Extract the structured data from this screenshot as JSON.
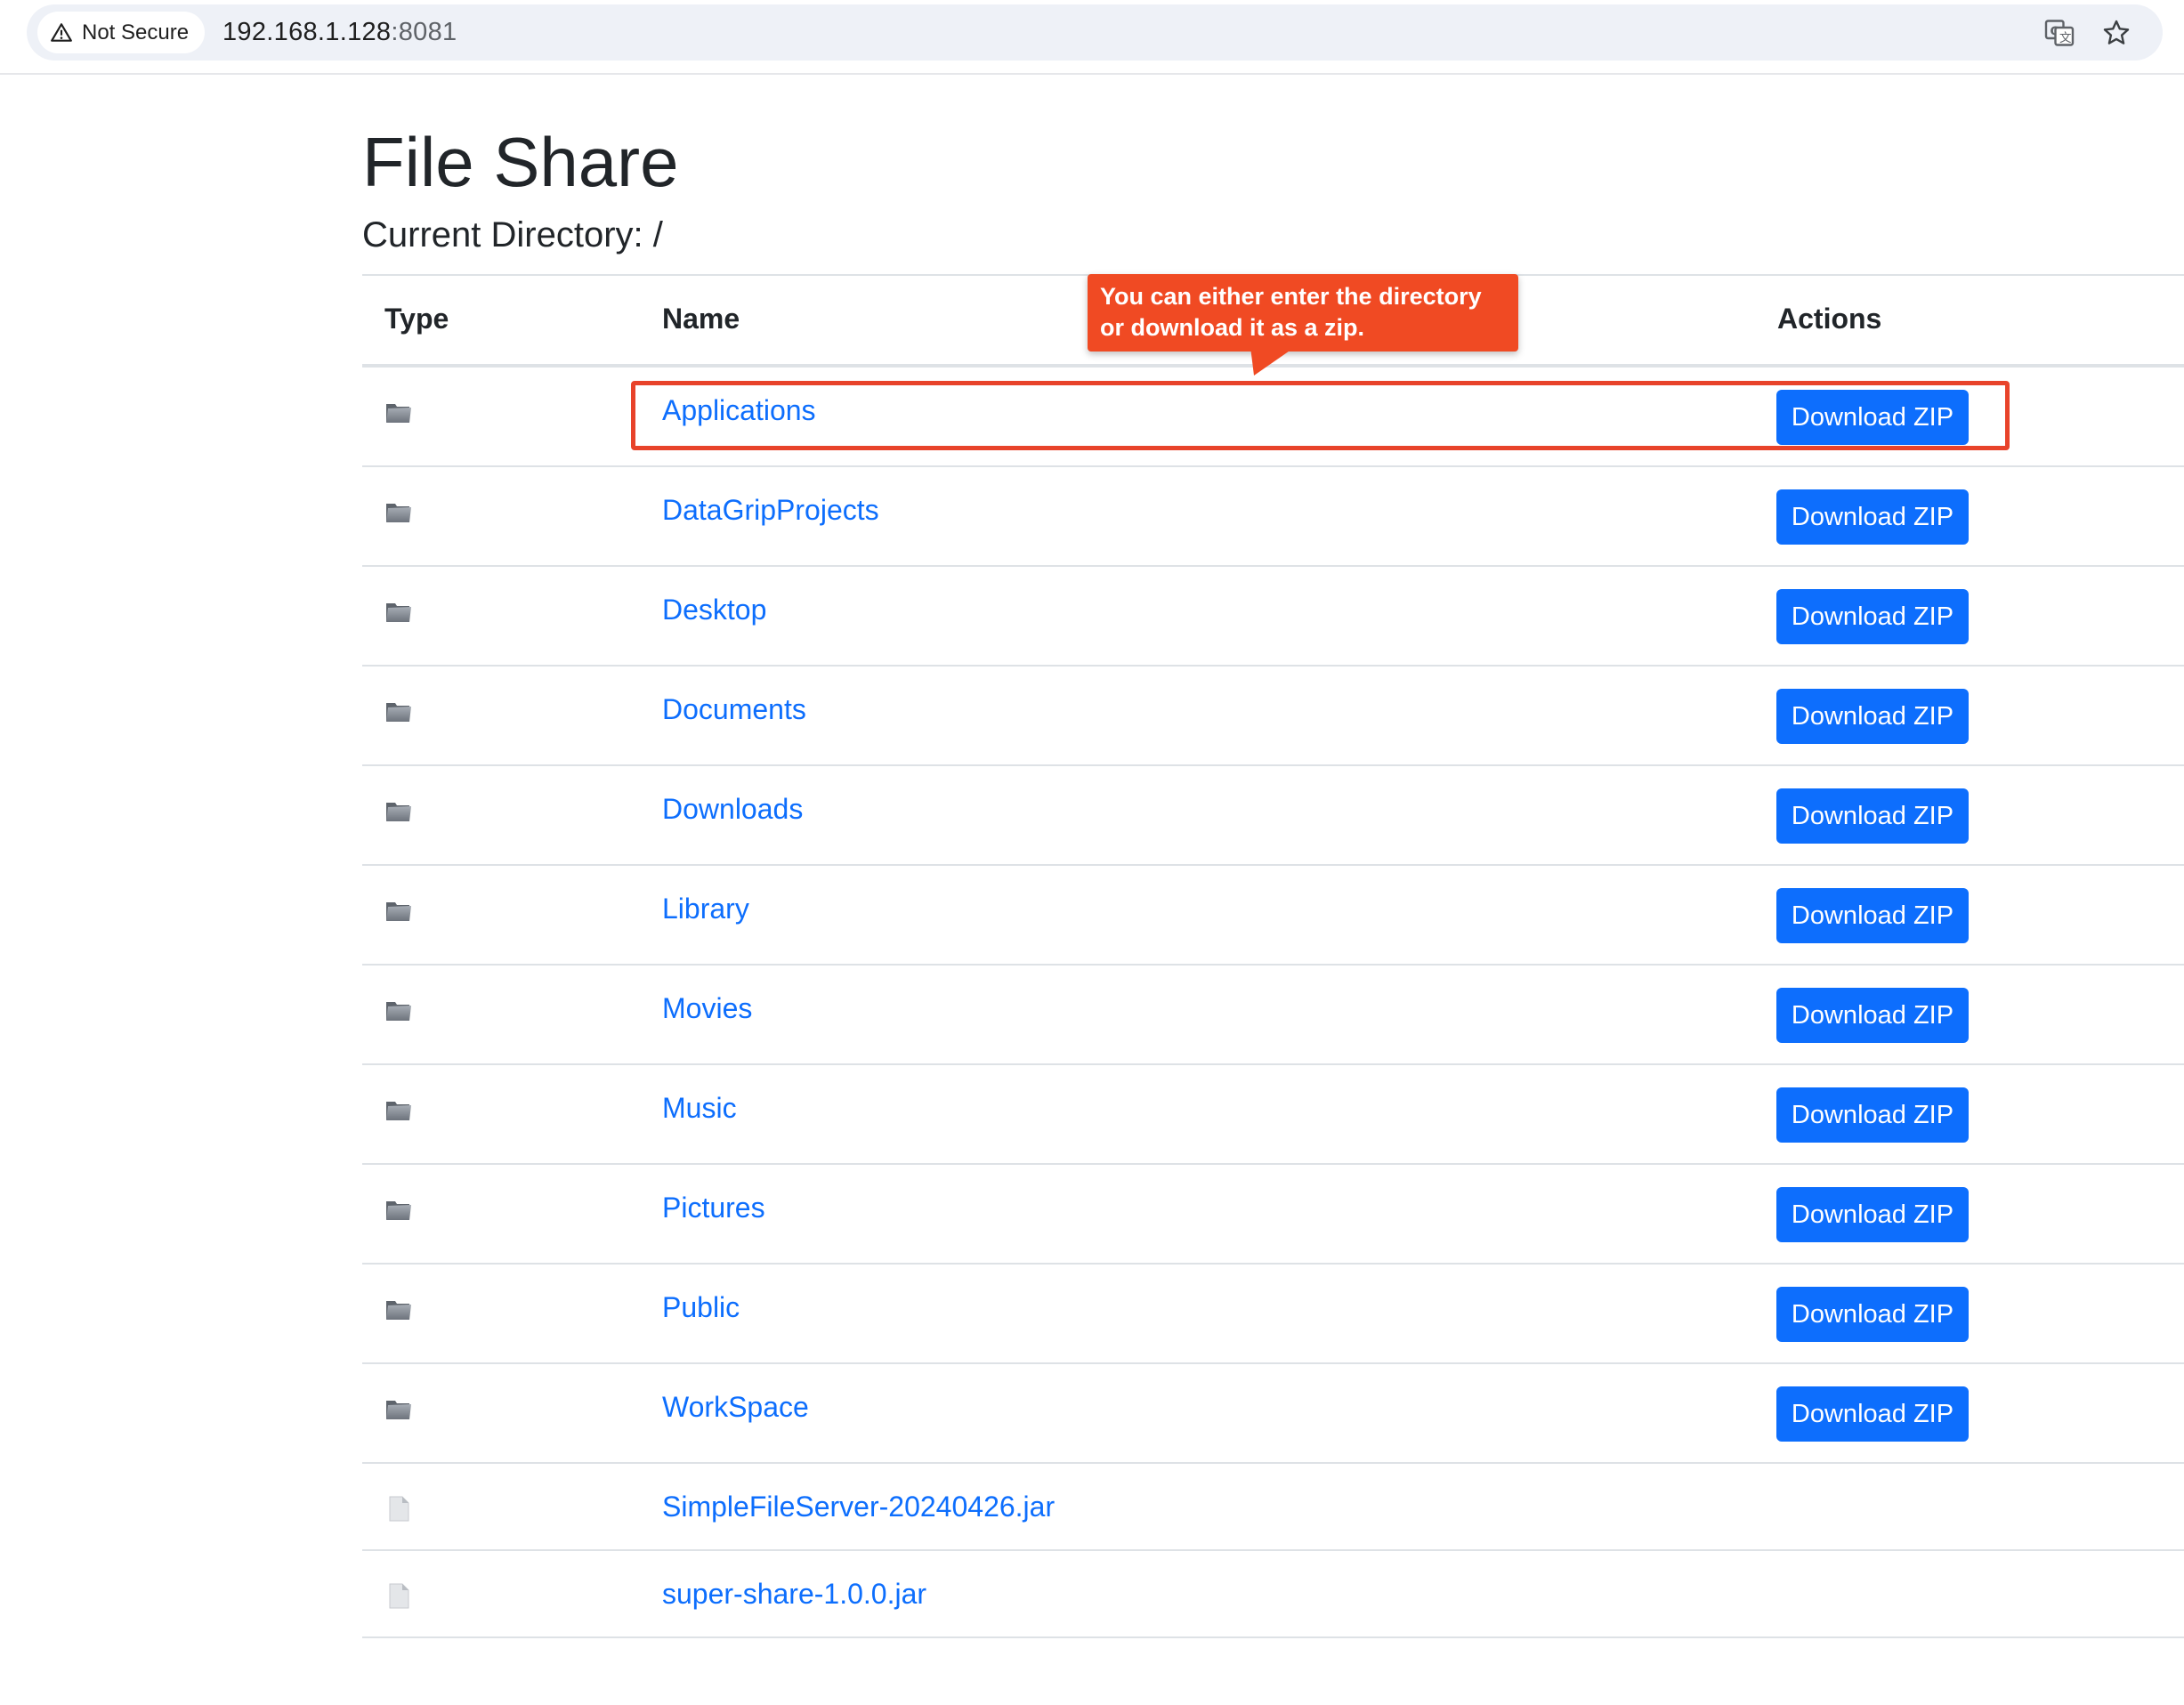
{
  "browser": {
    "security_label": "Not Secure",
    "url_host": "192.168.1.128",
    "url_port": ":8081"
  },
  "page": {
    "title": "File Share",
    "directory_label": "Current Directory:",
    "directory_path": "/"
  },
  "table": {
    "headers": {
      "type": "Type",
      "name": "Name",
      "actions": "Actions"
    },
    "download_label": "Download ZIP",
    "rows": [
      {
        "type": "folder",
        "name": "Applications"
      },
      {
        "type": "folder",
        "name": "DataGripProjects"
      },
      {
        "type": "folder",
        "name": "Desktop"
      },
      {
        "type": "folder",
        "name": "Documents"
      },
      {
        "type": "folder",
        "name": "Downloads"
      },
      {
        "type": "folder",
        "name": "Library"
      },
      {
        "type": "folder",
        "name": "Movies"
      },
      {
        "type": "folder",
        "name": "Music"
      },
      {
        "type": "folder",
        "name": "Pictures"
      },
      {
        "type": "folder",
        "name": "Public"
      },
      {
        "type": "folder",
        "name": "WorkSpace"
      },
      {
        "type": "file",
        "name": "SimpleFileServer-20240426.jar"
      },
      {
        "type": "file",
        "name": "super-share-1.0.0.jar"
      }
    ]
  },
  "annotation": {
    "callout_text": "You can either enter the directory or download it as a zip."
  },
  "colors": {
    "link": "#0d6efd",
    "button": "#0d6efd",
    "annotation": "#e8432a"
  }
}
